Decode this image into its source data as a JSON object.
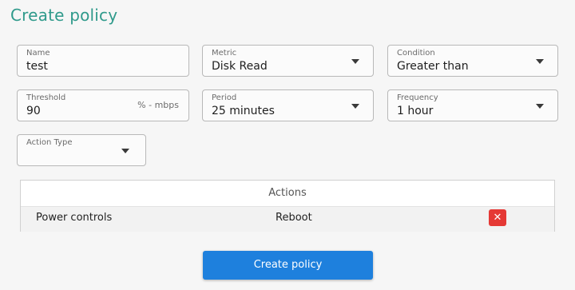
{
  "page": {
    "title": "Create policy"
  },
  "form": {
    "name": {
      "label": "Name",
      "value": "test"
    },
    "metric": {
      "label": "Metric",
      "value": "Disk Read"
    },
    "condition": {
      "label": "Condition",
      "value": "Greater than"
    },
    "threshold": {
      "label": "Threshold",
      "value": "90",
      "suffix": "% - mbps"
    },
    "period": {
      "label": "Period",
      "value": "25 minutes"
    },
    "frequency": {
      "label": "Frequency",
      "value": "1 hour"
    },
    "action_type": {
      "label": "Action Type",
      "value": ""
    }
  },
  "actions": {
    "header": "Actions",
    "rows": [
      {
        "type": "Power controls",
        "action": "Reboot",
        "delete_icon": "✕"
      }
    ]
  },
  "submit": {
    "label": "Create policy"
  },
  "colors": {
    "title": "#2f9a8b",
    "primary_button": "#1e80dd",
    "delete_button": "#e53935"
  }
}
